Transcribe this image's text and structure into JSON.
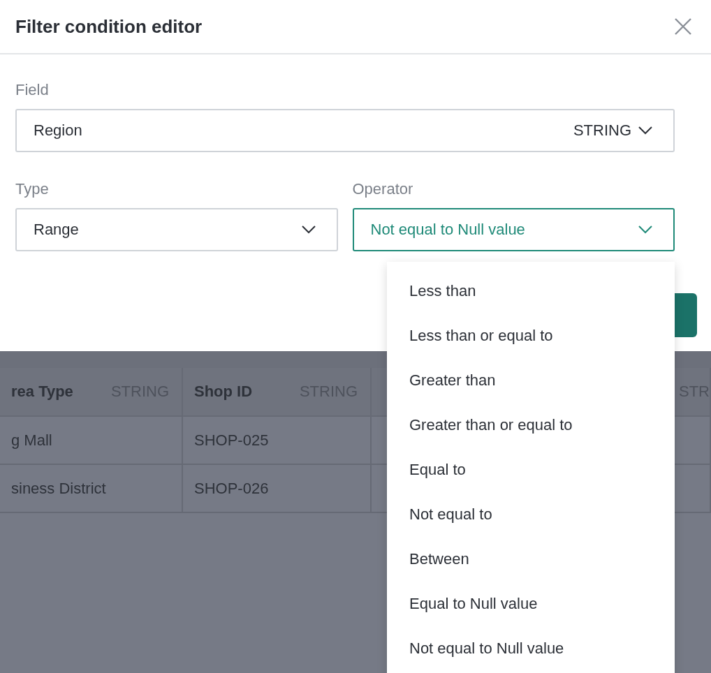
{
  "dialog": {
    "title": "Filter condition editor"
  },
  "field": {
    "label": "Field",
    "value": "Region",
    "type_badge": "STRING"
  },
  "type": {
    "label": "Type",
    "value": "Range"
  },
  "operator": {
    "label": "Operator",
    "value": "Not equal to Null value",
    "focused": true
  },
  "operator_menu": {
    "options": [
      {
        "label": "Less than"
      },
      {
        "label": "Less than or equal to"
      },
      {
        "label": "Greater than"
      },
      {
        "label": "Greater than or equal to"
      },
      {
        "label": "Equal to"
      },
      {
        "label": "Not equal to"
      },
      {
        "label": "Between"
      },
      {
        "label": "Equal to Null value"
      },
      {
        "label": "Not equal to Null value"
      }
    ]
  },
  "table": {
    "columns": [
      {
        "name": "rea Type",
        "type": "STRING"
      },
      {
        "name": "Shop ID",
        "type": "STRING"
      },
      {
        "type": "STR"
      }
    ],
    "rows": [
      [
        "g Mall",
        "SHOP-025"
      ],
      [
        "siness District",
        "SHOP-026"
      ]
    ]
  }
}
